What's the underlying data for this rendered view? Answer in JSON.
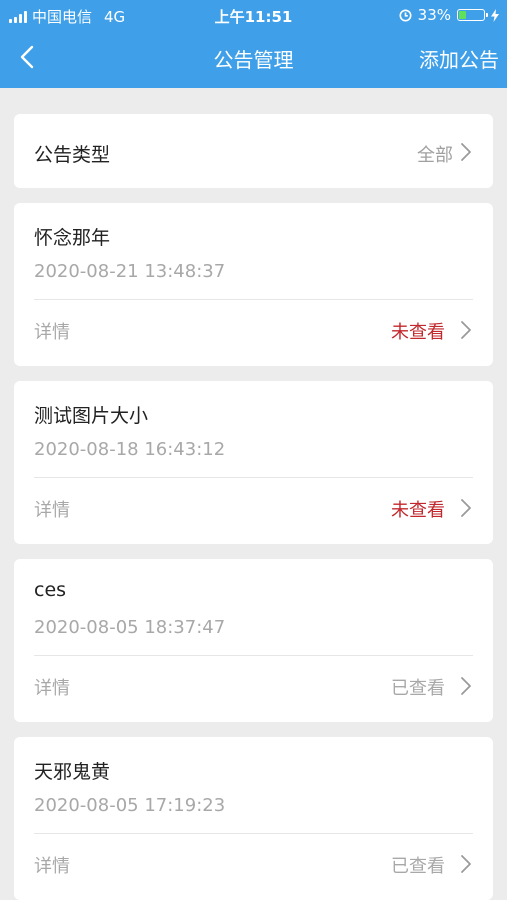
{
  "status_bar": {
    "carrier": "中国电信",
    "network": "4G",
    "time": "上午11:51",
    "battery": "33%",
    "battery_level": 0.33,
    "battery_color": "#5fe15a"
  },
  "navbar": {
    "title": "公告管理",
    "add_label": "添加公告",
    "background": "#3fa0e9"
  },
  "filter": {
    "label": "公告类型",
    "value": "全部"
  },
  "announcements": [
    {
      "title": "怀念那年",
      "date": "2020-08-21 13:48:37",
      "detail_label": "详情",
      "status": "未查看",
      "status_type": "unread"
    },
    {
      "title": "测试图片大小",
      "date": "2020-08-18 16:43:12",
      "detail_label": "详情",
      "status": "未查看",
      "status_type": "unread"
    },
    {
      "title": "ces",
      "date": "2020-08-05 18:37:47",
      "detail_label": "详情",
      "status": "已查看",
      "status_type": "read"
    },
    {
      "title": "天邪鬼黄",
      "date": "2020-08-05 17:19:23",
      "detail_label": "详情",
      "status": "已查看",
      "status_type": "read"
    }
  ],
  "colors": {
    "unread": "#c0282d",
    "read": "#a8a8a8",
    "page_bg": "#ececec"
  },
  "icons": {
    "back": "chevron-left-icon",
    "row_arrow": "chevron-right-icon",
    "signal": "signal-bars-icon",
    "alarm": "alarm-lock-icon",
    "battery": "battery-icon",
    "charging": "lightning-icon"
  }
}
